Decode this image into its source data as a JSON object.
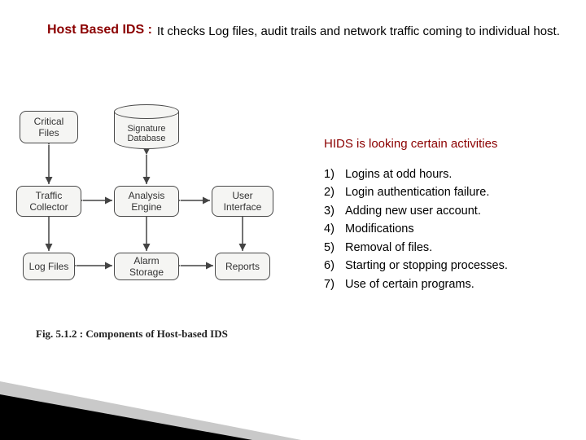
{
  "header": {
    "title": "Host Based IDS :",
    "description": "It checks Log files, audit trails and network traffic coming to individual host."
  },
  "diagram": {
    "nodes": {
      "critical_files": "Critical Files",
      "signature_db": "Signature Database",
      "traffic_collector": "Traffic Collector",
      "analysis_engine": "Analysis Engine",
      "user_interface": "User Interface",
      "log_files": "Log Files",
      "alarm_storage": "Alarm Storage",
      "reports": "Reports"
    },
    "caption": "Fig. 5.1.2 : Components of Host-based IDS"
  },
  "right": {
    "heading": "HIDS is looking certain activities",
    "items": [
      {
        "n": "1)",
        "t": "Logins at odd hours."
      },
      {
        "n": "2)",
        "t": "Login authentication failure."
      },
      {
        "n": "3)",
        "t": "Adding new user account."
      },
      {
        "n": "4)",
        "t": "Modifications"
      },
      {
        "n": "5)",
        "t": "Removal of files."
      },
      {
        "n": "6)",
        "t": "Starting or stopping processes."
      },
      {
        "n": "7)",
        "t": "Use of certain programs."
      }
    ]
  }
}
